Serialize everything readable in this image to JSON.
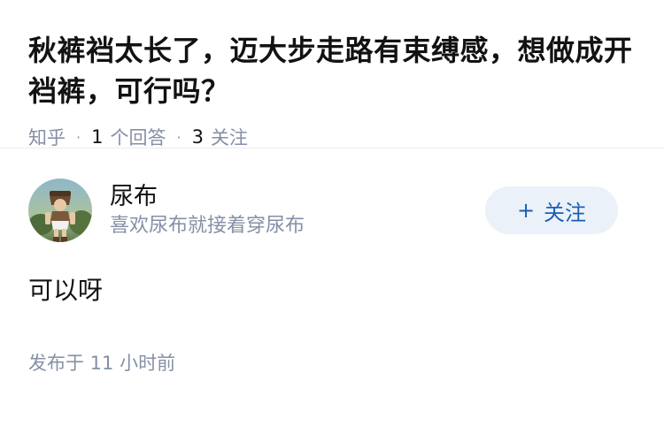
{
  "question": {
    "title": "秋裤裆太长了，迈大步走路有束缚感，想做成开裆裤，可行吗？",
    "source": "知乎",
    "answer_count": "1",
    "answer_label": "个回答",
    "follower_count": "3",
    "follower_label": "关注",
    "separator": "·"
  },
  "answer": {
    "author_name": "尿布",
    "author_bio": "喜欢尿布就接着穿尿布",
    "follow_plus": "+",
    "follow_label": "关注",
    "content": "可以呀",
    "published": "发布于 11 小时前"
  }
}
